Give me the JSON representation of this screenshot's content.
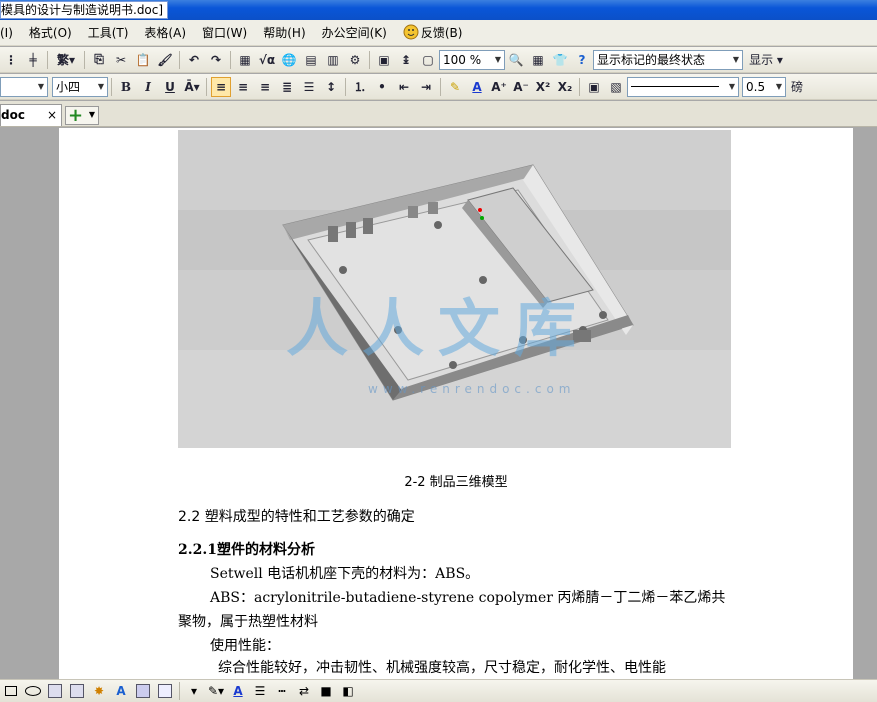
{
  "window": {
    "title": "模具的设计与制造说明书.doc]"
  },
  "menu": {
    "items": [
      "(I)",
      "格式(O)",
      "工具(T)",
      "表格(A)",
      "窗口(W)",
      "帮助(H)",
      "办公空间(K)"
    ],
    "feedback": "反馈(B)"
  },
  "toolbar1": {
    "zoom": "100 %",
    "markup_display": "显示标记的最终状态",
    "show_label": "显示"
  },
  "toolbar2": {
    "font_size": "小四",
    "line_weight": "0.5",
    "bold": "B",
    "italic": "I",
    "underline": "U",
    "trailing_char": "磅"
  },
  "tabs": {
    "doc_tab": "doc",
    "close": "×"
  },
  "document": {
    "caption": "2-2  制品三维模型",
    "heading2": "2.2 塑料成型的特性和工艺参数的确定",
    "heading3": "2.2.1塑件的材料分析",
    "p1": "Setwell 电话机机座下壳的材料为：ABS。",
    "p2": "ABS：acrylonitrile-butadiene-styrene copolymer 丙烯腈－丁二烯－苯乙烯共聚物，属于热塑性材料",
    "p3": "使用性能：",
    "p4": "综合性能较好，冲击韧性、机械强度较高，尺寸稳定，耐化学性、电性能",
    "watermark": "人人文库",
    "watermark_url": "www.renrendoc.com"
  }
}
